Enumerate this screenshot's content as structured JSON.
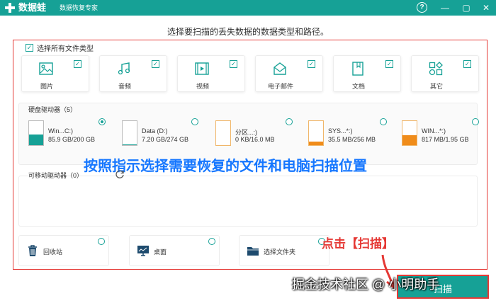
{
  "titlebar": {
    "brand": "数据蛙",
    "subtitle": "数据恢复专家",
    "help": "?",
    "minimize": "—",
    "maximize": "▢",
    "close": "✕",
    "color": "#16a196"
  },
  "instruction": "选择要扫描的丢失数据的数据类型和路径。",
  "select_all": {
    "label": "选择所有文件类型",
    "checked": true
  },
  "file_types": [
    {
      "label": "图片",
      "icon": "image-icon",
      "checked": true
    },
    {
      "label": "音频",
      "icon": "music-icon",
      "checked": true
    },
    {
      "label": "视频",
      "icon": "video-icon",
      "checked": true
    },
    {
      "label": "电子邮件",
      "icon": "email-icon",
      "checked": true
    },
    {
      "label": "文档",
      "icon": "document-icon",
      "checked": true
    },
    {
      "label": "其它",
      "icon": "other-icon",
      "checked": true
    }
  ],
  "disks": {
    "header": "硬盘驱动器（5）",
    "items": [
      {
        "name": "Win...C:)",
        "size": "85.9 GB/200 GB",
        "used": 0.43,
        "fill": "#16a196",
        "selected": true
      },
      {
        "name": "Data (D:)",
        "size": "7.20 GB/274 GB",
        "used": 0.03,
        "fill": "#16a196",
        "selected": false
      },
      {
        "name": "分区...:)",
        "size": "0 KB/16.0 MB",
        "used": 0.0,
        "fill": "#f08c1a",
        "selected": false
      },
      {
        "name": "SYS...*:)",
        "size": "35.5 MB/256 MB",
        "used": 0.14,
        "fill": "#f08c1a",
        "selected": false
      },
      {
        "name": "WIN...*:)",
        "size": "817 MB/1.95 GB",
        "used": 0.42,
        "fill": "#f08c1a",
        "selected": false
      }
    ]
  },
  "overlay_instruction": "按照指示选择需要恢复的文件和电脑扫描位置",
  "removable": {
    "header": "可移动驱动器（0）",
    "refresh_icon": "refresh-icon"
  },
  "locations": [
    {
      "label": "回收站",
      "icon": "trash-icon"
    },
    {
      "label": "桌面",
      "icon": "desktop-icon"
    },
    {
      "label": "选择文件夹",
      "icon": "folder-icon"
    }
  ],
  "annotation": {
    "click_scan": "点击【扫描】",
    "color": "#e53935"
  },
  "scan_button": {
    "label": "扫描"
  },
  "watermark": "掘金技术社区 @ 小明助手"
}
